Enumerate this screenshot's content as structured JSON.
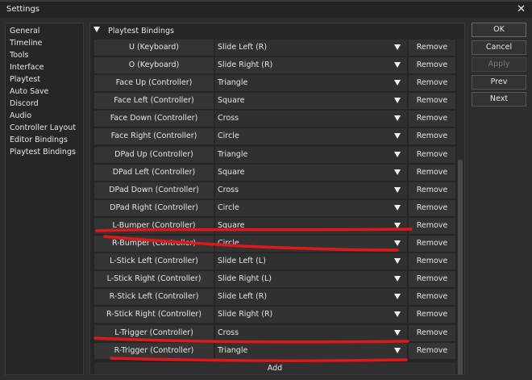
{
  "window": {
    "title": "Settings",
    "close_glyph": "✕"
  },
  "sidebar": {
    "items": [
      {
        "label": "General"
      },
      {
        "label": "Timeline"
      },
      {
        "label": "Tools"
      },
      {
        "label": "Interface"
      },
      {
        "label": "Playtest"
      },
      {
        "label": "Auto Save"
      },
      {
        "label": "Discord"
      },
      {
        "label": "Audio"
      },
      {
        "label": "Controller Layout"
      },
      {
        "label": "Editor Bindings"
      },
      {
        "label": "Playtest Bindings"
      }
    ]
  },
  "panel": {
    "section_title": "Playtest Bindings",
    "remove_label": "Remove",
    "add_label": "Add",
    "bindings": [
      {
        "key": "U  (Keyboard)",
        "action": "Slide Left (R)"
      },
      {
        "key": "O  (Keyboard)",
        "action": "Slide Right (R)"
      },
      {
        "key": "Face Up  (Controller)",
        "action": "Triangle"
      },
      {
        "key": "Face Left  (Controller)",
        "action": "Square"
      },
      {
        "key": "Face Down  (Controller)",
        "action": "Cross"
      },
      {
        "key": "Face Right  (Controller)",
        "action": "Circle"
      },
      {
        "key": "DPad Up  (Controller)",
        "action": "Triangle"
      },
      {
        "key": "DPad Left  (Controller)",
        "action": "Square"
      },
      {
        "key": "DPad Down  (Controller)",
        "action": "Cross"
      },
      {
        "key": "DPad Right  (Controller)",
        "action": "Circle"
      },
      {
        "key": "L-Bumper  (Controller)",
        "action": "Square"
      },
      {
        "key": "R-Bumper  (Controller)",
        "action": "Circle"
      },
      {
        "key": "L-Stick Left  (Controller)",
        "action": "Slide Left (L)"
      },
      {
        "key": "L-Stick Right  (Controller)",
        "action": "Slide Right (L)"
      },
      {
        "key": "R-Stick Left  (Controller)",
        "action": "Slide Left (R)"
      },
      {
        "key": "R-Stick Right  (Controller)",
        "action": "Slide Right (R)"
      },
      {
        "key": "L-Trigger  (Controller)",
        "action": "Cross"
      },
      {
        "key": "R-Trigger  (Controller)",
        "action": "Triangle"
      }
    ]
  },
  "buttons": {
    "ok": "OK",
    "cancel": "Cancel",
    "apply": "Apply",
    "prev": "Prev",
    "next": "Next"
  },
  "icons": {
    "collapse": "caret-down-icon",
    "dropdown": "dropdown-arrow-icon",
    "close": "close-icon"
  },
  "colors": {
    "window_bg": "#2d2d2d",
    "titlebar_bg": "#242424",
    "panel_bg": "#262626",
    "annotation": "#e0181b"
  }
}
